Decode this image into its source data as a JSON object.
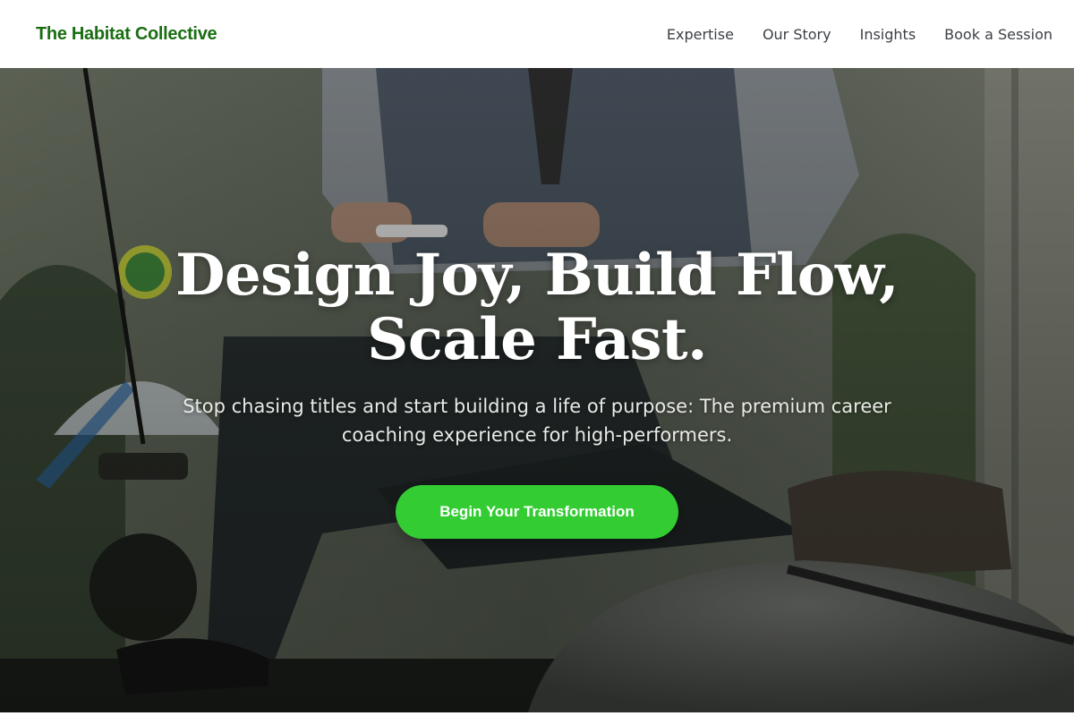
{
  "header": {
    "brand": "The Habitat Collective",
    "nav": [
      {
        "label": "Expertise"
      },
      {
        "label": "Our Story"
      },
      {
        "label": "Insights"
      },
      {
        "label": "Book a Session"
      }
    ]
  },
  "hero": {
    "title_line1": "Design Joy, Build Flow,",
    "title_line2": "Scale Fast.",
    "subtitle": "Stop chasing titles and start building a life of purpose: The premium career coaching experience for high-performers.",
    "cta_label": "Begin Your Transformation",
    "background_image": "man-on-carriage-writing-notes"
  },
  "colors": {
    "brand": "#1a6e12",
    "cta": "#33cc33",
    "nav_text": "#3c3f44"
  }
}
